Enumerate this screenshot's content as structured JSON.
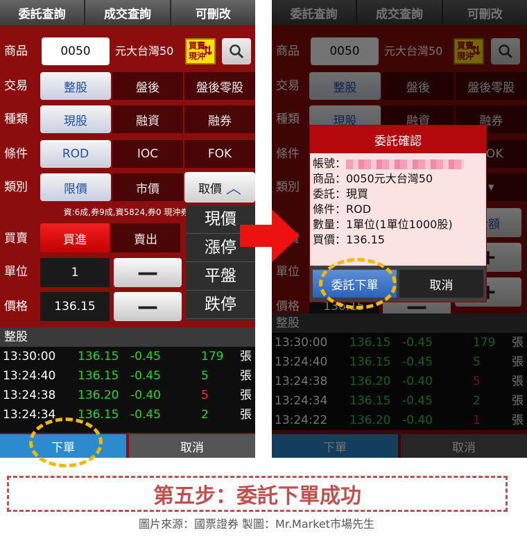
{
  "colors": {
    "brand_red": "#8b0d0d",
    "accent_red": "#e00000",
    "up_green": "#27d827",
    "down_red": "#ff2a2a",
    "order_blue": "#2c8bcd",
    "highlight_yellow": "#f5b800"
  },
  "tabs": [
    "委託查詢",
    "成交查詢",
    "可刪改"
  ],
  "form": {
    "product_label": "商品",
    "product_code": "0050",
    "product_name": "元大台灣50",
    "badge_line1": "買賣",
    "badge_line2": "現沖",
    "badge_icon": "arrow-up-down-icon",
    "search_icon": "search-icon",
    "trade_label": "交易",
    "trade_options": [
      "整股",
      "盤後",
      "盤後零股"
    ],
    "type_label": "種類",
    "type_options": [
      "現股",
      "融資",
      "融券"
    ],
    "cond_label": "條件",
    "cond_options": [
      "ROD",
      "IOC",
      "FOK"
    ],
    "category_label": "類別",
    "category_options": [
      "限價",
      "市價",
      "取價"
    ],
    "info_line": "資:6成,券9成,資5824,券0 現沖券:",
    "side_label": "買賣",
    "buy": "買進",
    "sell": "賣出",
    "unit_label": "單位",
    "unit_value": "1",
    "price_label": "價格",
    "price_value": "136.15",
    "minus": "—",
    "price_btn_right": "金額"
  },
  "price_dropdown": [
    "現價",
    "漲停",
    "平盤",
    "跌停"
  ],
  "ticks_header": "整股",
  "ticks_left": [
    {
      "time": "13:30:00",
      "price": "136.15",
      "change": "-0.45",
      "volume": "179",
      "unit": "張",
      "vol_color": "green"
    },
    {
      "time": "13:24:40",
      "price": "136.15",
      "change": "-0.45",
      "volume": "5",
      "unit": "張",
      "vol_color": "green"
    },
    {
      "time": "13:24:38",
      "price": "136.20",
      "change": "-0.40",
      "volume": "5",
      "unit": "張",
      "vol_color": "red"
    },
    {
      "time": "13:24:34",
      "price": "136.15",
      "change": "-0.45",
      "volume": "2",
      "unit": "張",
      "vol_color": "green"
    }
  ],
  "ticks_right": [
    {
      "time": "13:30:00",
      "price": "136.15",
      "change": "-0.45",
      "volume": "179",
      "unit": "張",
      "vol_color": "green"
    },
    {
      "time": "13:24:40",
      "price": "136.15",
      "change": "-0.45",
      "volume": "5",
      "unit": "張",
      "vol_color": "green"
    },
    {
      "time": "13:24:38",
      "price": "136.20",
      "change": "-0.40",
      "volume": "5",
      "unit": "張",
      "vol_color": "red"
    },
    {
      "time": "13:24:34",
      "price": "136.15",
      "change": "-0.45",
      "volume": "2",
      "unit": "張",
      "vol_color": "green"
    },
    {
      "time": "13:24:22",
      "price": "136.20",
      "change": "-0.40",
      "volume": "1",
      "unit": "張",
      "vol_color": "red"
    }
  ],
  "bottom": {
    "order": "下單",
    "cancel": "取消"
  },
  "dialog": {
    "title": "委託確認",
    "account_label": "帳號：",
    "product": "商品：0050元大台灣50",
    "order": "委託：現買",
    "condition": "條件：ROD",
    "quantity": "數量：1單位(1單位1000股)",
    "price": "買價：136.15",
    "confirm": "委託下單",
    "cancel": "取消"
  },
  "caption": {
    "step": "第五步：委託下單成功",
    "source": "圖片來源：國票證券 製圖：Mr.Market市場先生"
  }
}
